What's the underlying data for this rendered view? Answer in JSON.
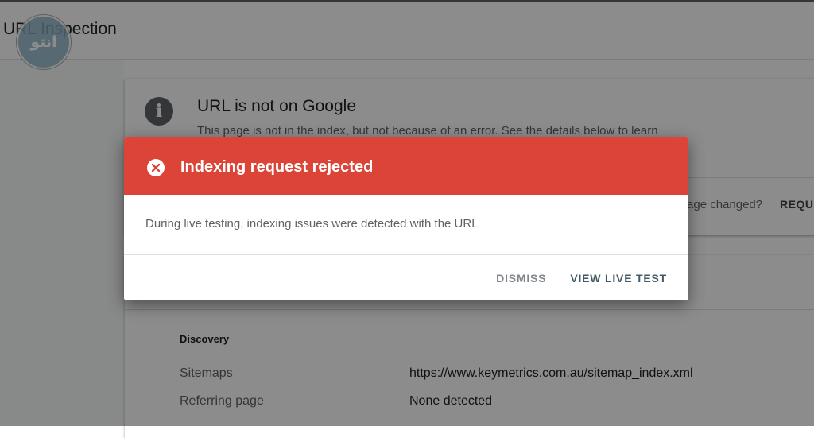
{
  "page": {
    "title": "URL Inspection",
    "watermark_text": "انتو"
  },
  "status_card": {
    "title": "URL is not on Google",
    "description": "This page is not in the index, but not because of an error. See the details below to learn",
    "page_changed_question": "Page changed?",
    "request_button": "REQU"
  },
  "details": {
    "section_title": "Discovery",
    "rows": [
      {
        "label": "Sitemaps",
        "value": "https://www.keymetrics.com.au/sitemap_index.xml"
      },
      {
        "label": "Referring page",
        "value": "None detected"
      }
    ]
  },
  "dialog": {
    "title": "Indexing request rejected",
    "message": "During live testing, indexing issues were detected with the URL",
    "dismiss_label": "DISMISS",
    "view_live_test_label": "VIEW LIVE TEST",
    "header_color": "#db4437",
    "header_icon": "error-x-icon"
  }
}
